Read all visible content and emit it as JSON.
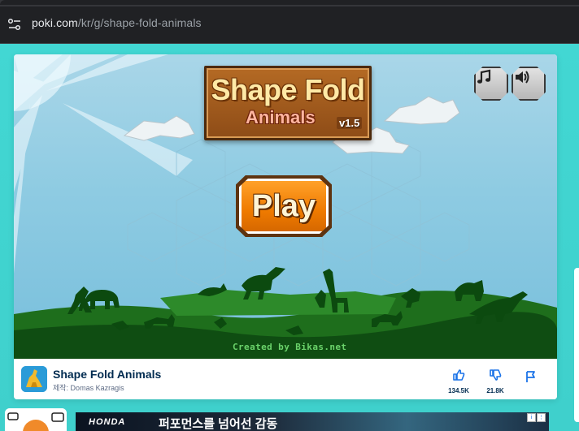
{
  "browser": {
    "url_host": "poki.com",
    "url_path": "/kr/g/shape-fold-animals"
  },
  "game": {
    "logo_line1": "Shape Fold",
    "logo_line2": "Animals",
    "version": "v1.5",
    "play_label": "Play",
    "credit": "Created by Bikas.net",
    "music_icon": "music-note-icon",
    "sound_icon": "speaker-icon"
  },
  "info": {
    "title": "Shape Fold Animals",
    "maker": "제작: Domas Kazragis",
    "likes": "134.5K",
    "dislikes": "21.8K"
  },
  "ad": {
    "brand": "HONDA",
    "headline": "퍼포먼스를 넘어선 감동"
  },
  "colors": {
    "page_bg": "#3ad2cf",
    "title_text": "#002b50",
    "play_orange": "#ef7a00",
    "thumbs_blue": "#1b73e8"
  }
}
